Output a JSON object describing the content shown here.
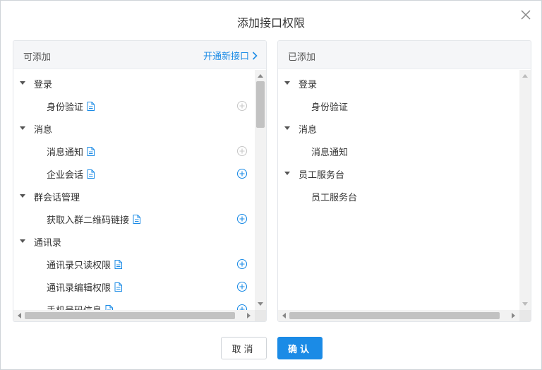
{
  "dialog": {
    "title": "添加接口权限",
    "close_icon": "close-icon"
  },
  "available": {
    "title": "可添加",
    "link": "开通新接口",
    "rows": [
      {
        "kind": "group",
        "label": "登录"
      },
      {
        "kind": "leaf",
        "label": "身份验证",
        "state": "disabled"
      },
      {
        "kind": "group",
        "label": "消息"
      },
      {
        "kind": "leaf",
        "label": "消息通知",
        "state": "disabled"
      },
      {
        "kind": "leaf",
        "label": "企业会话",
        "state": "enabled"
      },
      {
        "kind": "group",
        "label": "群会话管理"
      },
      {
        "kind": "leaf",
        "label": "获取入群二维码链接",
        "state": "enabled"
      },
      {
        "kind": "group",
        "label": "通讯录"
      },
      {
        "kind": "leaf",
        "label": "通讯录只读权限",
        "state": "enabled"
      },
      {
        "kind": "leaf",
        "label": "通讯录编辑权限",
        "state": "enabled"
      },
      {
        "kind": "leaf",
        "label": "手机号码信息",
        "state": "enabled"
      }
    ]
  },
  "added": {
    "title": "已添加",
    "rows": [
      {
        "kind": "group",
        "label": "登录"
      },
      {
        "kind": "leaf",
        "label": "身份验证"
      },
      {
        "kind": "group",
        "label": "消息"
      },
      {
        "kind": "leaf",
        "label": "消息通知"
      },
      {
        "kind": "group",
        "label": "员工服务台"
      },
      {
        "kind": "leaf",
        "label": "员工服务台"
      }
    ]
  },
  "footer": {
    "cancel_label": "取消",
    "ok_label": "确认"
  },
  "colors": {
    "accent": "#1b8be6",
    "disabled_icon": "#c8c8c8",
    "border": "#cfd3d8"
  }
}
